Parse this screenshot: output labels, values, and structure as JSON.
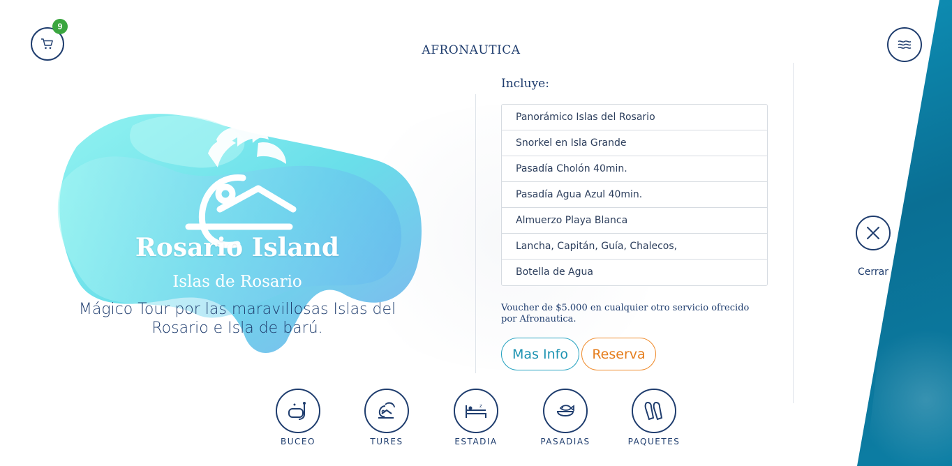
{
  "header": {
    "cart_count": "9",
    "logo_text": "AFRONAUTICA"
  },
  "hero": {
    "title": "Rosario Island",
    "subtitle": "Islas de Rosario",
    "description_line1": "Mágico Tour por las maravillosas Islas del",
    "description_line2": "Rosario e Isla de barú."
  },
  "includes": {
    "title": "Incluye:",
    "items": [
      "Panorámico Islas del Rosario",
      "Snorkel en Isla Grande",
      "Pasadía Cholón 40min.",
      "Pasadía Agua Azul 40min.",
      "Almuerzo Playa Blanca",
      "Lancha, Capitán, Guía, Chalecos,",
      "Botella de Agua"
    ],
    "voucher_line1": "Voucher de $5.000 en cualquier otro servicio ofrecido",
    "voucher_line2": "por Afronautica."
  },
  "actions": {
    "info_label": "Mas Info",
    "reserve_label": "Reserva",
    "close_label": "Cerrar"
  },
  "categories": [
    {
      "label": "BUCEO",
      "icon": "diving-mask-icon"
    },
    {
      "label": "TURES",
      "icon": "palm-island-icon"
    },
    {
      "label": "ESTADIA",
      "icon": "bed-icon"
    },
    {
      "label": "PASADIAS",
      "icon": "fish-plate-icon"
    },
    {
      "label": "PAQUETES",
      "icon": "flippers-icon"
    }
  ],
  "colors": {
    "navy": "#1f3d6e",
    "teal": "#27a3c0",
    "orange": "#ef8b2c",
    "badge_green": "#3aa63f",
    "wedge": "#0c7ea4"
  }
}
